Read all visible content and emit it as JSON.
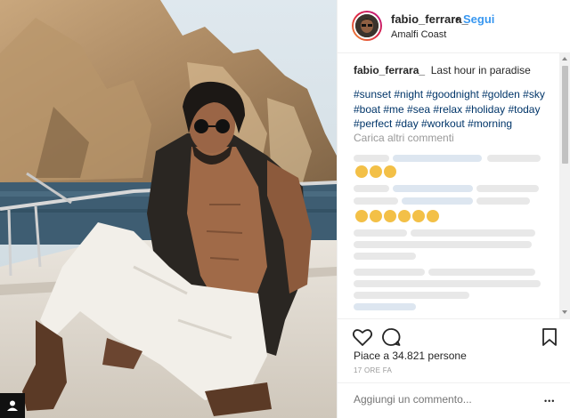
{
  "post": {
    "username": "fabio_ferrara_",
    "follow_label": "Segui",
    "separator": "•",
    "location": "Amalfi Coast",
    "caption_text": "Last hour in paradise",
    "hashtags": "#sunset #night #goodnight #golden #sky #boat #me #sea #relax #holiday #today #perfect #day #workout #morning",
    "load_more": "Carica altri commenti",
    "likes": "Piace a 34.821 persone",
    "time": "17 ORE FA",
    "comment_placeholder": "Aggiungi un commento...",
    "more_glyph": "•••"
  },
  "icons": {
    "like": "heart-icon",
    "comment": "comment-bubble-icon",
    "save": "bookmark-icon",
    "more": "more-options-icon",
    "corner": "user-tag-icon"
  },
  "colors": {
    "link": "#003569",
    "follow": "#3897f0",
    "text": "#262626",
    "muted": "#999999"
  }
}
